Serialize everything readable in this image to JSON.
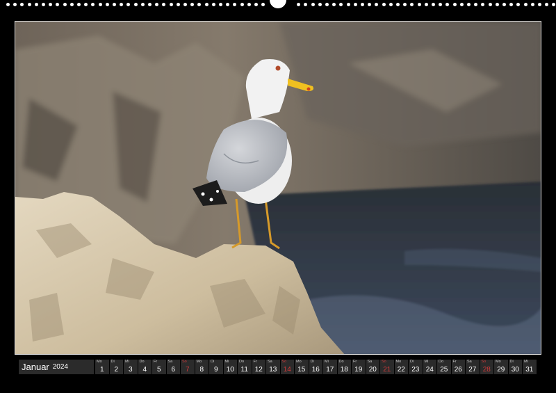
{
  "calendar": {
    "month": "Januar",
    "year": "2024",
    "sunday_color": "#d23a3a",
    "days": [
      {
        "wd": "Mo",
        "num": "1",
        "sunday": false
      },
      {
        "wd": "Di",
        "num": "2",
        "sunday": false
      },
      {
        "wd": "Mi",
        "num": "3",
        "sunday": false
      },
      {
        "wd": "Do",
        "num": "4",
        "sunday": false
      },
      {
        "wd": "Fr",
        "num": "5",
        "sunday": false
      },
      {
        "wd": "Sa",
        "num": "6",
        "sunday": false
      },
      {
        "wd": "So",
        "num": "7",
        "sunday": true
      },
      {
        "wd": "Mo",
        "num": "8",
        "sunday": false
      },
      {
        "wd": "Di",
        "num": "9",
        "sunday": false
      },
      {
        "wd": "Mi",
        "num": "10",
        "sunday": false
      },
      {
        "wd": "Do",
        "num": "11",
        "sunday": false
      },
      {
        "wd": "Fr",
        "num": "12",
        "sunday": false
      },
      {
        "wd": "Sa",
        "num": "13",
        "sunday": false
      },
      {
        "wd": "So",
        "num": "14",
        "sunday": true
      },
      {
        "wd": "Mo",
        "num": "15",
        "sunday": false
      },
      {
        "wd": "Di",
        "num": "16",
        "sunday": false
      },
      {
        "wd": "Mi",
        "num": "17",
        "sunday": false
      },
      {
        "wd": "Do",
        "num": "18",
        "sunday": false
      },
      {
        "wd": "Fr",
        "num": "19",
        "sunday": false
      },
      {
        "wd": "Sa",
        "num": "20",
        "sunday": false
      },
      {
        "wd": "So",
        "num": "21",
        "sunday": true
      },
      {
        "wd": "Mo",
        "num": "22",
        "sunday": false
      },
      {
        "wd": "Di",
        "num": "23",
        "sunday": false
      },
      {
        "wd": "Mi",
        "num": "24",
        "sunday": false
      },
      {
        "wd": "Do",
        "num": "25",
        "sunday": false
      },
      {
        "wd": "Fr",
        "num": "26",
        "sunday": false
      },
      {
        "wd": "Sa",
        "num": "27",
        "sunday": false
      },
      {
        "wd": "So",
        "num": "28",
        "sunday": true
      },
      {
        "wd": "Mo",
        "num": "29",
        "sunday": false
      },
      {
        "wd": "Di",
        "num": "30",
        "sunday": false
      },
      {
        "wd": "Mi",
        "num": "31",
        "sunday": false
      }
    ]
  },
  "photo": {
    "subject": "seagull-on-rock",
    "colors": {
      "cliff": "#6e6459",
      "water": "#25303f",
      "rock": "#d6c8ad",
      "bird_body": "#eeeeee",
      "bird_wing": "#b9bcc2",
      "beak": "#f0c020"
    }
  }
}
